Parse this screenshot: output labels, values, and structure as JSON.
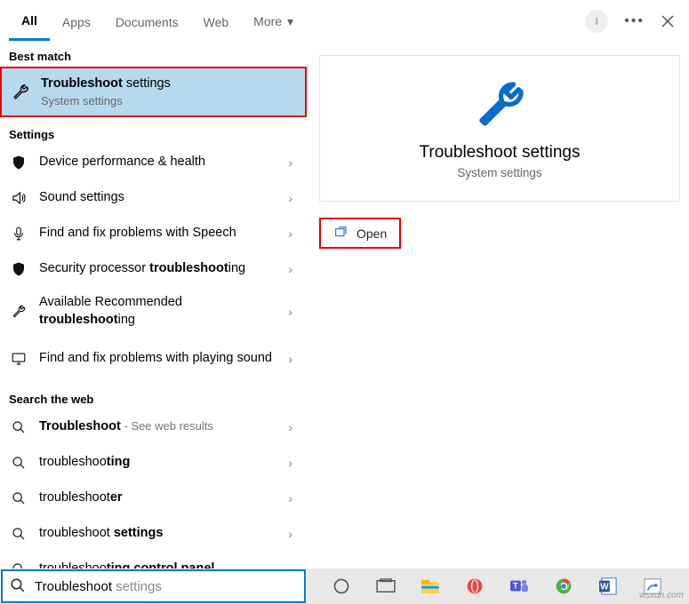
{
  "tabs": {
    "all": "All",
    "apps": "Apps",
    "documents": "Documents",
    "web": "Web",
    "more": "More"
  },
  "avatar_initial": "I",
  "sections": {
    "best_match": "Best match",
    "settings": "Settings",
    "search_web": "Search the web"
  },
  "best_match": {
    "title_bold": "Troubleshoot",
    "title_rest": " settings",
    "subtitle": "System settings"
  },
  "settings_items": {
    "i0": "Device performance & health",
    "i1": "Sound settings",
    "i2": "Find and fix problems with Speech",
    "i3_pre": "Security processor ",
    "i3_b": "troubleshoot",
    "i3_post": "ing",
    "i4_pre": "Available Recommended ",
    "i4_b": "troubleshoot",
    "i4_post": "ing",
    "i5": "Find and fix problems with playing sound"
  },
  "web_items": {
    "w0_b": "Troubleshoot",
    "w0_sub": " - See web results",
    "w1_pre": "troubleshoo",
    "w1_b": "ting",
    "w2_pre": "troubleshoot",
    "w2_b": "er",
    "w3_pre": "troubleshoot ",
    "w3_b": "settings",
    "w4_pre": "troubleshoo",
    "w4_b": "ting control panel"
  },
  "preview": {
    "title": "Troubleshoot settings",
    "subtitle": "System settings",
    "open": "Open"
  },
  "search": {
    "typed": "Troubleshoot",
    "completion": " settings"
  },
  "watermark": "wsxdn.com"
}
